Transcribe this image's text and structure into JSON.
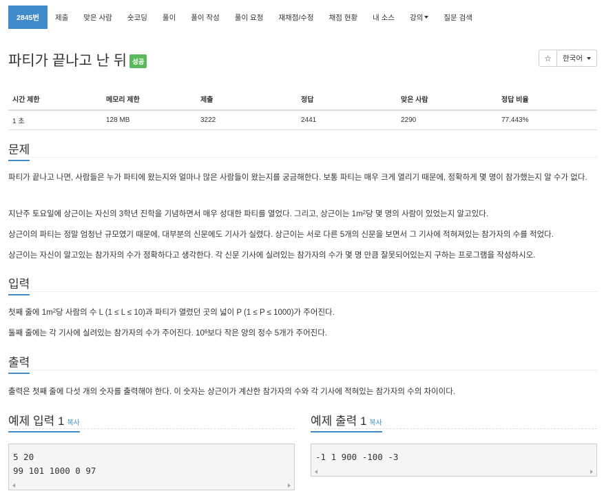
{
  "nav": {
    "items": [
      {
        "label": "2845번",
        "active": true
      },
      {
        "label": "제출"
      },
      {
        "label": "맞은 사람"
      },
      {
        "label": "숏코딩"
      },
      {
        "label": "풀이"
      },
      {
        "label": "풀이 작성"
      },
      {
        "label": "풀이 요청"
      },
      {
        "label": "재채점/수정"
      },
      {
        "label": "채점 현황"
      },
      {
        "label": "내 소스"
      },
      {
        "label": "강의"
      },
      {
        "label": "질문 검색"
      }
    ]
  },
  "problem": {
    "title": "파티가 끝나고 난 뒤",
    "badge": "성공",
    "star": "☆",
    "language": "한국어"
  },
  "info": {
    "headers": [
      "시간 제한",
      "메모리 제한",
      "제출",
      "정답",
      "맞은 사람",
      "정답 비율"
    ],
    "values": [
      "1 초",
      "128 MB",
      "3222",
      "2441",
      "2290",
      "77.443%"
    ]
  },
  "sections": {
    "problem_title": "문제",
    "problem_p1": "파티가 끝나고 나면, 사람들은 누가 파티에 왔는지와 얼마나 많은 사람들이 왔는지를 궁금해한다. 보통 파티는 매우 크게 열리기 때문에, 정확하게 몇 명이 참가했는지 알 수가 없다.",
    "problem_p2_a": "지난주 토요일에 상근이는 자신의 3학년 진학을 기념하면서 매우 성대한 파티를 열었다. 그리고, 상근이는 1m",
    "problem_p2_sup": "2",
    "problem_p2_b": "당 몇 명의 사람이 있었는지 알고있다.",
    "problem_p3": "상근이의 파티는 정말 엄청난 규모였기 때문에, 대부분의 신문에도 기사가 실렸다. 상근이는 서로 다른 5개의 신문을 보면서 그 기사에 적혀져있는 참가자의 수를 적었다.",
    "problem_p4": "상근이는 자신이 알고있는 참가자의 수가 정확하다고 생각한다. 각 신문 기사에 실려있는 참가자의 수가 몇 명 만큼 잘못되어있는지 구하는 프로그램을 작성하시오.",
    "input_title": "입력",
    "input_p1_a": "첫째 줄에 1m",
    "input_p1_sup": "2",
    "input_p1_b": "당 사람의 수 L (1 ≤ L ≤ 10)과 파티가 열렸던 곳의 넓이 P (1 ≤ P ≤ 1000)가 주어진다.",
    "input_p2_a": "둘째 줄에는 각 기사에 실려있는 참가자의 수가 주어진다. 10",
    "input_p2_sup": "6",
    "input_p2_b": "보다 작은 양의 정수 5개가 주어진다.",
    "output_title": "출력",
    "output_p1": "출력은 첫째 줄에 다섯 개의 숫자를 출력해야 한다. 이 숫자는 상근이가 계산한 참가자의 수와  각 기사에 적혀있는 참가자의 수의 차이이다."
  },
  "samples": {
    "input_title": "예제 입력 1",
    "output_title": "예제 출력 1",
    "copy_label": "복사",
    "input_text": "5 20\n99 101 1000 0 97",
    "output_text": "-1 1 900 -100 -3"
  },
  "colors": {
    "accent": "#428bca",
    "success": "#5cb85c"
  }
}
